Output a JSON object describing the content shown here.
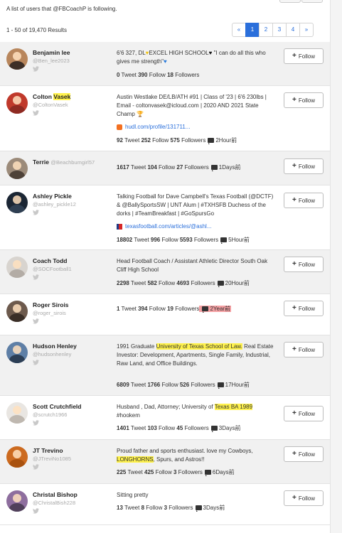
{
  "caption": "A list of users that @FBCoachP is following.",
  "results_text": "1 - 50 of 19,470 Results",
  "pagination": {
    "prev": "«",
    "pages": [
      "1",
      "2",
      "3",
      "4"
    ],
    "next": "»",
    "active_page": "1"
  },
  "follow_label": "Follow",
  "users": [
    {
      "name": "Benjamin lee",
      "handle": "@Ben_lee2023",
      "bio_a": "6'6 327, DL",
      "bio_b": "EXCEL HIGH SCHOOL",
      "bio_c": " \"I can do all this who gives me strength\"",
      "tweets": "0",
      "follows": "390",
      "followers": "18",
      "tweet_label": "Tweet",
      "follow_label": "Follow",
      "followers_label": "Followers",
      "avatar_colors": [
        "#b8865c",
        "#3d2f27"
      ]
    },
    {
      "name": "Colton ",
      "name_hl": "Vasek",
      "handle": "@ColtonVasek",
      "bio": "Austin Westlake DE/LB/ATH #91 | Class of '23 | 6'6 230lbs | Email - coltonvasek@icloud.com | 2020 AND 2021 State Champ",
      "link": "hudl.com/profile/131711...",
      "tweets": "92",
      "follows": "252",
      "followers": "575",
      "time": "2Hour前",
      "avatar_colors": [
        "#c0392b",
        "#8e2a22"
      ]
    },
    {
      "name": "Terrie",
      "handle": "@Beachbumgirl57",
      "tweets": "1617",
      "follows": "104",
      "followers": "27",
      "time": "1Days前",
      "avatar_colors": [
        "#9c8b7a",
        "#4e4238"
      ]
    },
    {
      "name": "Ashley Pickle",
      "handle": "@ashley_pickle12",
      "bio": "Talking Football for Dave Campbell's Texas Football (@DCTF) & @BallySportsSW | UNT Alum | #TXHSFB Duchess of the dorks | #TeamBreakfast | #GoSpursGo",
      "link": "texasfootball.com/articles/@ashl...",
      "tweets": "18802",
      "follows": "996",
      "followers": "5593",
      "time": "5Hour前",
      "avatar_colors": [
        "#1b2634",
        "#2f3f52"
      ]
    },
    {
      "name": "Coach Todd",
      "handle": "@SOCFootball1",
      "bio": "Head Football Coach / Assistant Athletic Director South Oak Cliff High School",
      "tweets": "2298",
      "follows": "582",
      "followers": "4693",
      "time": "20Hour前",
      "avatar_colors": [
        "#d8d4cf",
        "#b3aca5"
      ]
    },
    {
      "name": "Roger Sirois",
      "handle": "@roger_sirois",
      "tweets": "1",
      "follows": "394",
      "followers": "19",
      "time": "2Year前",
      "avatar_colors": [
        "#6d5a4d",
        "#3a2e27"
      ]
    },
    {
      "name": "Hudson Henley",
      "handle": "@hudsonhenley",
      "bio_a": "1991 Graduate ",
      "bio_hl": "University of Texas School of Law.",
      "bio_c": " Real Estate Investor: Development, Apartments, Single Family, Industrial, Raw Land, and Office Buildings.",
      "tweets": "6809",
      "follows": "1766",
      "followers": "526",
      "time": "17Hour前",
      "avatar_colors": [
        "#5e7fa6",
        "#2c3e55"
      ]
    },
    {
      "name": "Scott Crutchfield",
      "handle": "@scrutch1966",
      "bio_a": "Husband , Dad, Attorney; University of ",
      "bio_hl": "Texas BA 1989",
      "bio_c": " #hookem",
      "tweets": "1401",
      "follows": "103",
      "followers": "45",
      "time": "3Days前",
      "avatar_colors": [
        "#e9e6e2",
        "#bfb8b0"
      ]
    },
    {
      "name": "JT Trevino",
      "handle": "@JTreviNo1085",
      "bio_a": "Proud father and sports enthusiast. love my Cowboys, ",
      "bio_hl": "LONGHORNS",
      "bio_c": ", Spurs, and Astros!!",
      "tweets": "225",
      "follows": "425",
      "followers": "3",
      "time": "6Days前",
      "avatar_colors": [
        "#cc6a1f",
        "#a9520f"
      ]
    },
    {
      "name": "Christal Bishop",
      "handle": "@ChristalBish228",
      "bio": "Sitting pretty",
      "tweets": "13",
      "follows": "8",
      "followers": "3",
      "time": "3Days前",
      "avatar_colors": [
        "#8e6e9e",
        "#50405a"
      ]
    }
  ]
}
